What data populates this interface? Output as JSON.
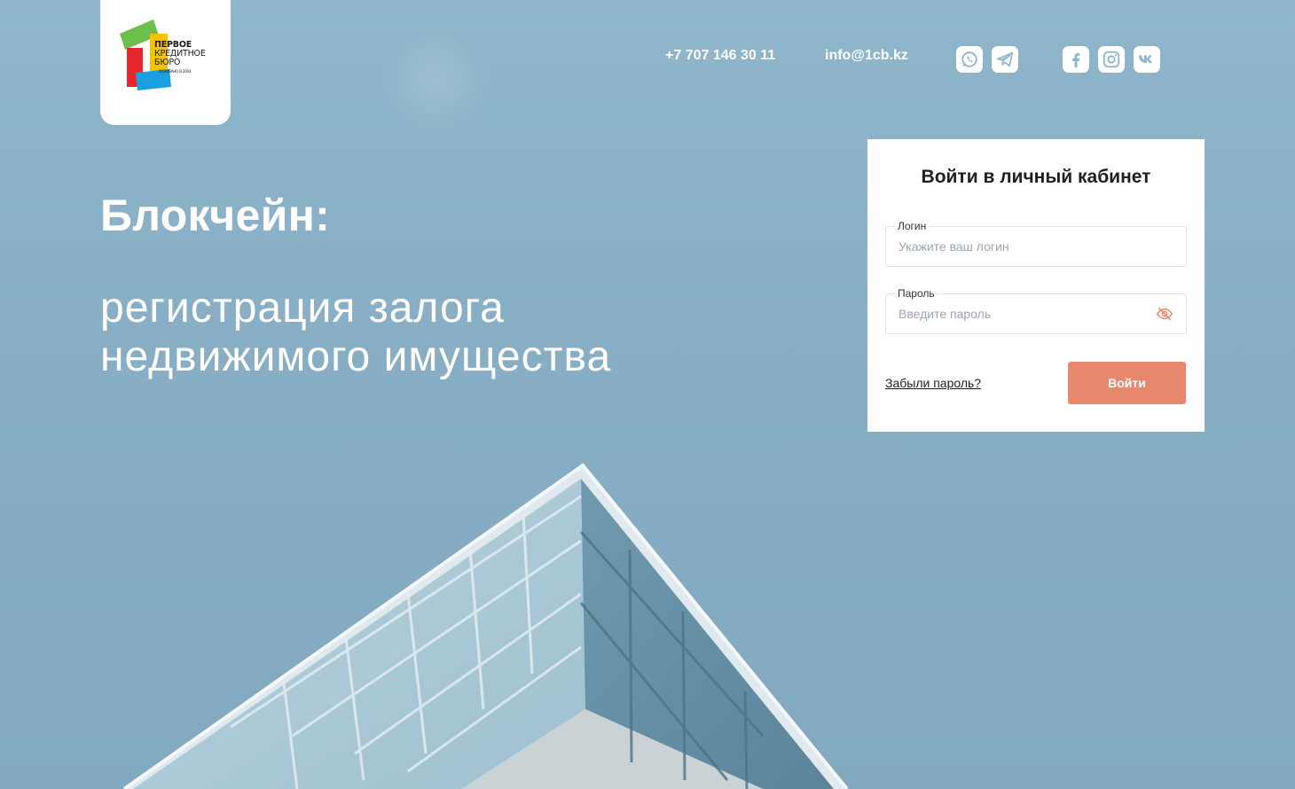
{
  "logo": {
    "line1": "ПЕРВОЕ",
    "line2": "КРЕДИТНОЕ",
    "line3": "БЮРО",
    "line4": "ОСНОВАНО В 2004",
    "colors": {
      "green": "#6dbf4b",
      "yellow": "#f5c400",
      "red": "#e8262d",
      "blue": "#1aa0e0"
    }
  },
  "header": {
    "phone": "+7 707 146 30 11",
    "email": "info@1cb.kz",
    "socials": [
      {
        "name": "whatsapp-icon"
      },
      {
        "name": "telegram-icon"
      },
      {
        "name": "facebook-icon"
      },
      {
        "name": "instagram-icon"
      },
      {
        "name": "vk-icon"
      }
    ]
  },
  "hero": {
    "title": "Блокчейн:",
    "subtitle_line1": "регистрация залога",
    "subtitle_line2": "недвижимого имущества"
  },
  "login": {
    "title": "Войти в личный кабинет",
    "login_label": "Логин",
    "login_placeholder": "Укажите ваш логин",
    "login_value": "",
    "password_label": "Пароль",
    "password_placeholder": "Введите пароль",
    "password_value": "",
    "forgot_label": "Забыли пароль?",
    "submit_label": "Войти"
  },
  "colors": {
    "accent": "#e8896f",
    "icon": "#8fb5c9",
    "sky": "#8fb6cb"
  }
}
